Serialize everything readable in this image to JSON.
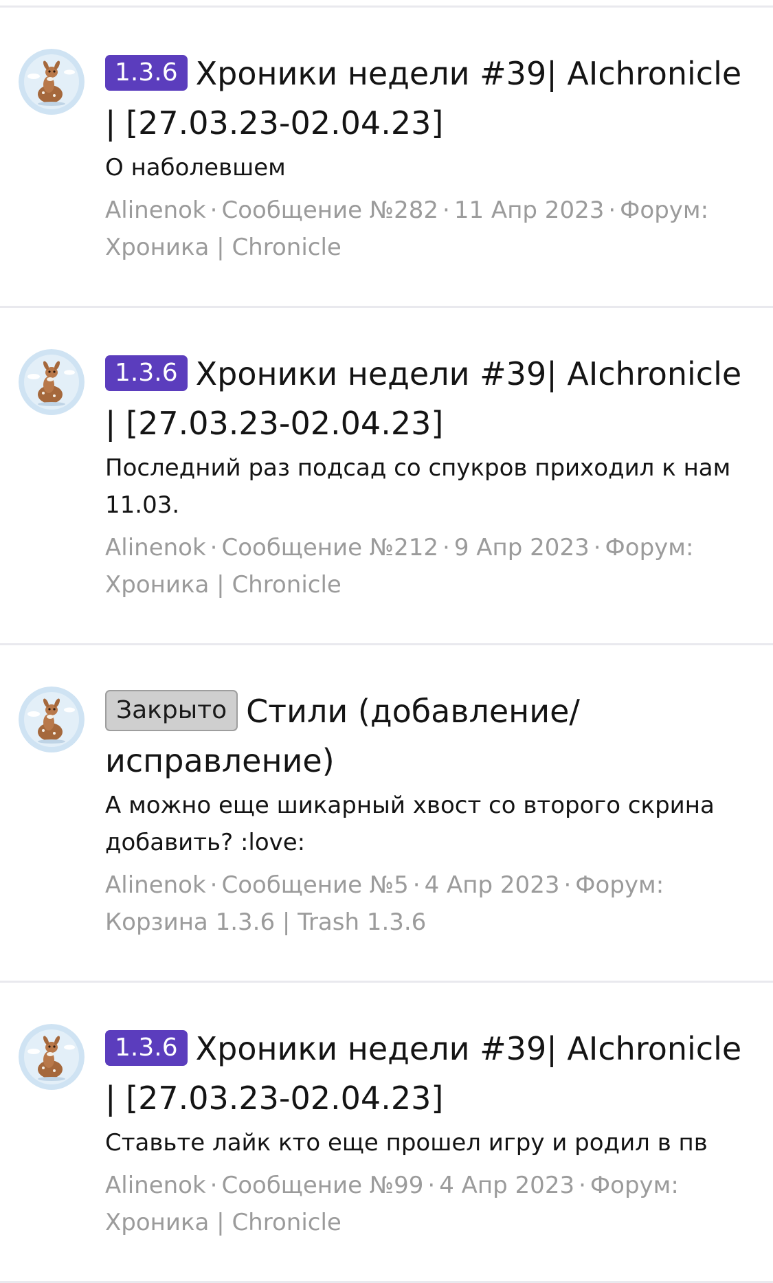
{
  "results": [
    {
      "prefix": "1.3.6",
      "prefix_type": "version",
      "title": "Хроники недели #39| AIchronicle | [27.03.23-02.04.23]",
      "snippet": "О наболевшем",
      "author": "Alinenok",
      "post": "Сообщение №282",
      "date": "11 Апр 2023",
      "forum": "Форум: Хроника | Chronicle"
    },
    {
      "prefix": "1.3.6",
      "prefix_type": "version",
      "title": "Хроники недели #39| AIchronicle | [27.03.23-02.04.23]",
      "snippet": "Последний раз подсад со спукров приходил к нам 11.03.",
      "author": "Alinenok",
      "post": "Сообщение №212",
      "date": "9 Апр 2023",
      "forum": "Форум: Хроника | Chronicle"
    },
    {
      "prefix": "Закрыто",
      "prefix_type": "closed",
      "title": "Стили (добавление/исправление)",
      "snippet": "А можно еще шикарный хвост со второго скрина добавить? :love:",
      "author": "Alinenok",
      "post": "Сообщение №5",
      "date": "4 Апр 2023",
      "forum": "Форум: Корзина 1.3.6 | Trash 1.3.6"
    },
    {
      "prefix": "1.3.6",
      "prefix_type": "version",
      "title": "Хроники недели #39| AIchronicle | [27.03.23-02.04.23]",
      "snippet": "Ставьте лайк кто еще прошел игру и родил в пв",
      "author": "Alinenok",
      "post": "Сообщение №99",
      "date": "4 Апр 2023",
      "forum": "Форум: Хроника | Chronicle"
    }
  ],
  "meta_separator": "·",
  "colors": {
    "version_prefix": "#5b3dbd",
    "closed_prefix": "#cfcfcf",
    "meta_text": "#9b9b9b",
    "divider": "#e9e9ee"
  },
  "icons": {
    "avatar": "fawn-avatar-icon"
  }
}
